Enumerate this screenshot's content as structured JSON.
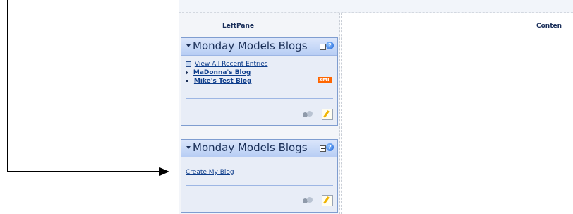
{
  "layout_panes": {
    "left_title": "LeftPane",
    "content_title": "Conten"
  },
  "modules": [
    {
      "title": "Monday Models Blogs",
      "items": [
        {
          "label": "View All Recent Entries",
          "bullet": "square"
        },
        {
          "label": "MaDonna's Blog",
          "bullet": "triangle"
        },
        {
          "label": "Mike's Test Blog",
          "bullet": "dot",
          "badge": "XML"
        }
      ]
    },
    {
      "title": "Monday Models Blogs",
      "items": [
        {
          "label": "Create My Blog"
        }
      ]
    }
  ],
  "colors": {
    "connector": "#000000",
    "module_border": "#7f9dd0",
    "link": "#0f3e8c",
    "xml_badge": "#ff6600"
  },
  "icons": [
    "minus-icon",
    "help-icon",
    "people-icon",
    "edit-icon"
  ]
}
